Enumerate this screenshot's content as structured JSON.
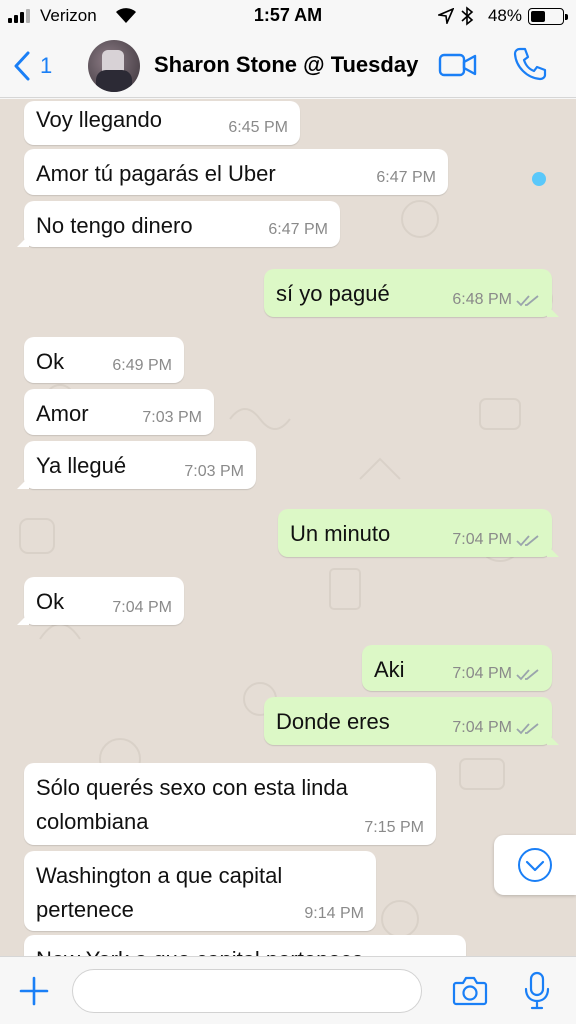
{
  "status_bar": {
    "carrier": "Verizon",
    "time": "1:57 AM",
    "battery_percent": "48%",
    "battery_level": 0.48
  },
  "header": {
    "back_count": "1",
    "contact_name": "Sharon Stone @ Tuesday",
    "icons": [
      "back-chevron-icon",
      "video-call-icon",
      "phone-call-icon"
    ]
  },
  "messages": [
    {
      "dir": "in",
      "text": "Voy llegando",
      "time": "6:45 PM"
    },
    {
      "dir": "in",
      "text": "Amor tú pagarás el Uber",
      "time": "6:47 PM"
    },
    {
      "dir": "in",
      "text": "No tengo dinero",
      "time": "6:47 PM"
    },
    {
      "dir": "out",
      "text": "sí yo pagué",
      "time": "6:48 PM"
    },
    {
      "dir": "in",
      "text": "Ok",
      "time": "6:49 PM"
    },
    {
      "dir": "in",
      "text": "Amor",
      "time": "7:03 PM"
    },
    {
      "dir": "in",
      "text": "Ya llegué",
      "time": "7:03 PM"
    },
    {
      "dir": "out",
      "text": "Un minuto",
      "time": "7:04 PM"
    },
    {
      "dir": "in",
      "text": "Ok",
      "time": "7:04 PM"
    },
    {
      "dir": "out",
      "text": "Aki",
      "time": "7:04 PM"
    },
    {
      "dir": "out",
      "text": "Donde eres",
      "time": "7:04 PM"
    },
    {
      "dir": "in",
      "text": "Sólo querés sexo con esta linda colombiana",
      "time": "7:15 PM"
    },
    {
      "dir": "in",
      "text": "Washington a que capital pertenece",
      "time": "9:14 PM"
    },
    {
      "dir": "in",
      "text": "New York a que capital pertenece",
      "time": ""
    }
  ],
  "input_bar": {
    "placeholder": "",
    "icons": [
      "plus-icon",
      "camera-icon",
      "microphone-icon"
    ]
  },
  "colors": {
    "accent": "#1a7ff6",
    "incoming_bubble": "#ffffff",
    "outgoing_bubble": "#dcf8c6",
    "chat_background": "#e5ddd5",
    "read_ticks": "#9aa4ac"
  }
}
